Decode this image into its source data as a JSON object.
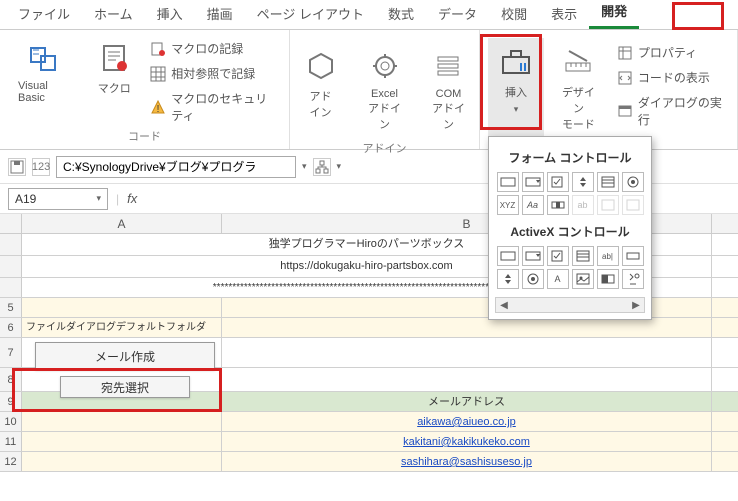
{
  "tabs": [
    "ファイル",
    "ホーム",
    "挿入",
    "描画",
    "ページ レイアウト",
    "数式",
    "データ",
    "校閲",
    "表示",
    "開発"
  ],
  "activeTab": 9,
  "ribbon": {
    "code": {
      "vb": "Visual Basic",
      "macro": "マクロ",
      "record": "マクロの記録",
      "relative": "相対参照で記録",
      "security": "マクロのセキュリティ",
      "label": "コード"
    },
    "addin": {
      "addin": "アド\nイン",
      "excel": "Excel\nアドイン",
      "com": "COM\nアドイン",
      "label": "アドイン"
    },
    "ctrl": {
      "insert": "挿入",
      "design": "デザイン\nモード",
      "props": "プロパティ",
      "viewcode": "コードの表示",
      "dialog": "ダイアログの実行"
    }
  },
  "subbar": {
    "path": "C:¥SynologyDrive¥ブログ¥プログラ"
  },
  "namebox": "A19",
  "sheet": {
    "cols": [
      "A",
      "B"
    ],
    "title1": "独学プログラマーHiroのパーツボックス",
    "title2": "https://dokugaku-hiro-partsbox.com",
    "asterisks": "*******************************************************************************",
    "row6": "ファイルダイアログデフォルトフォルダ",
    "btn1": "メール作成",
    "btn2": "宛先選択",
    "header9b": "メールアドレス",
    "emails": [
      "aikawa@aiueo.co.jp",
      "kakitani@kakikukeko.com",
      "sashihara@sashisuseso.jp"
    ],
    "rownums": [
      "",
      "",
      "",
      "5",
      "6",
      "7",
      "8",
      "9",
      "10",
      "11",
      "12"
    ]
  },
  "popup": {
    "h1": "フォーム コントロール",
    "h2": "ActiveX コントロール"
  }
}
